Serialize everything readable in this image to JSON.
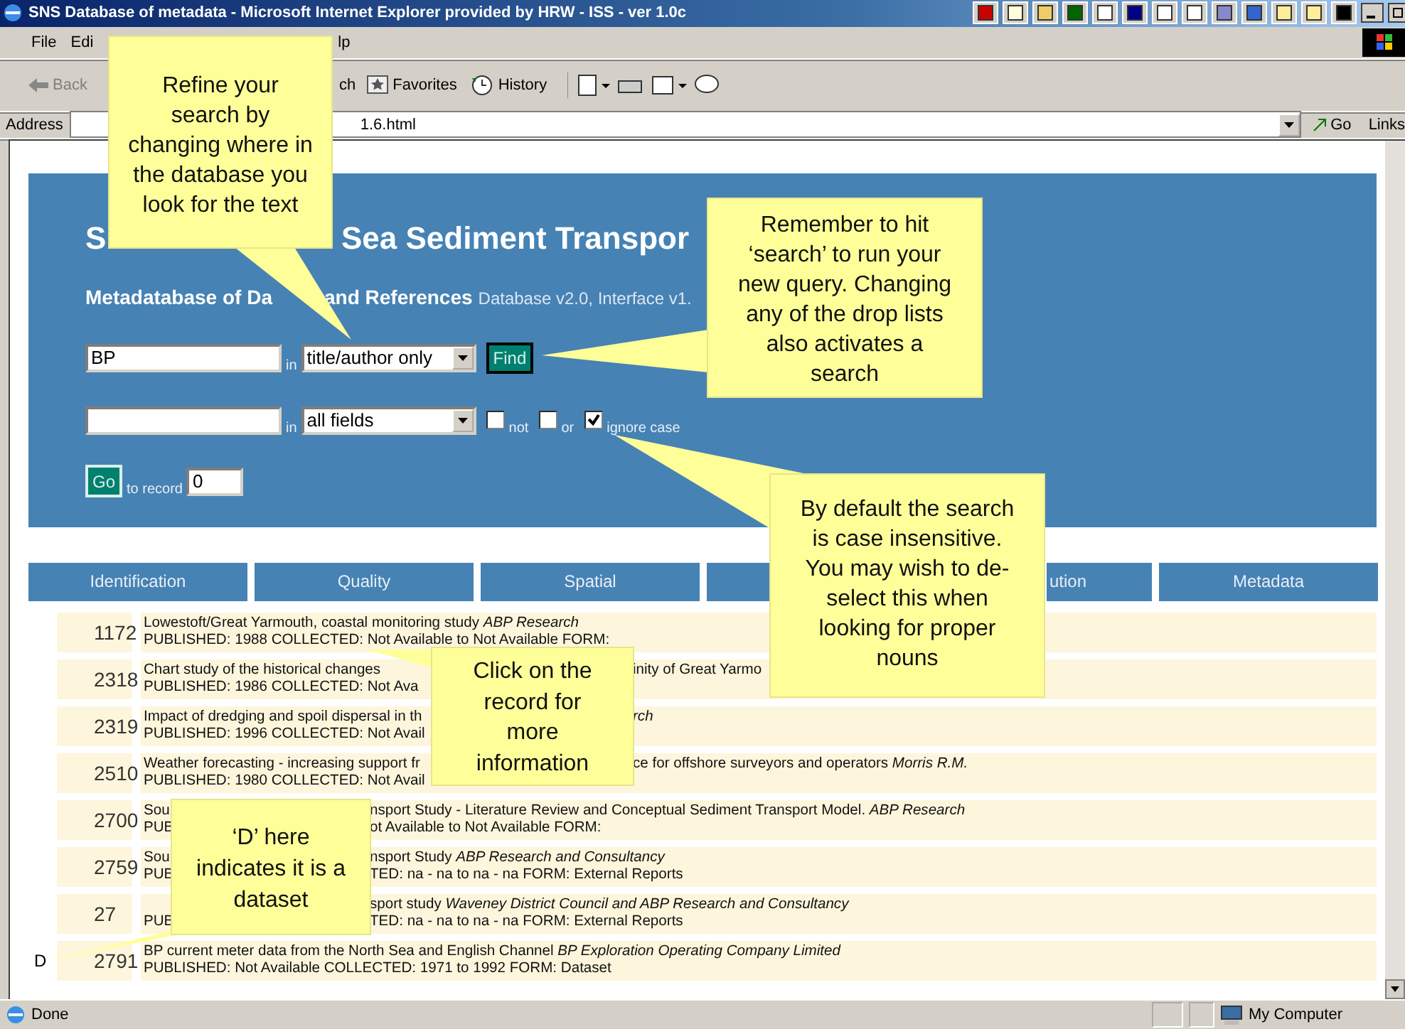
{
  "window": {
    "title": "SNS Database of metadata - Microsoft Internet Explorer provided by HRW - ISS - ver 1.0c"
  },
  "menu": [
    "File",
    "Edi",
    "lp"
  ],
  "toolbar": [
    {
      "label": "Back",
      "disabled": true
    },
    {
      "label": "ch",
      "disabled": false
    },
    {
      "label": "Favorites",
      "disabled": false
    },
    {
      "label": "History",
      "disabled": false
    }
  ],
  "address": {
    "label": "Address",
    "value": "1.6.html",
    "go": "Go",
    "links": "Links"
  },
  "page": {
    "title": {
      "left": "S",
      "right": "Sea Sediment Transpor"
    },
    "subtitle": {
      "left": "Metadatabase of Da",
      "right": "and References"
    },
    "version": "Database v2.0, Interface v1.",
    "query1": {
      "value": "BP",
      "in": "in",
      "field": "title/author only",
      "button": "Find"
    },
    "query2": {
      "in": "in",
      "field": "all fields",
      "checks": [
        {
          "label": "not",
          "checked": false
        },
        {
          "label": "or",
          "checked": false
        },
        {
          "label": "ignore case",
          "checked": true
        }
      ]
    },
    "goto": {
      "button": "Go",
      "label": "to record",
      "value": "0"
    }
  },
  "column_tabs": [
    {
      "kind": "labeled",
      "label": "Identification"
    },
    {
      "kind": "labeled",
      "label": "Quality"
    },
    {
      "kind": "labeled",
      "label": "Spatial"
    },
    {
      "kind": "covered"
    },
    {
      "kind": "cut",
      "label": "ution"
    },
    {
      "kind": "labeled",
      "label": "Metadata"
    }
  ],
  "records": [
    {
      "number": "1172",
      "line1": {
        "left": "Lowestoft/Great Yarmouth, coastal monitoring study *ABP Research*"
      },
      "line2": {
        "left": "PUBLISHED: 1988 COLLECTED: Not Available to Not Available FORM:"
      }
    },
    {
      "number": "2318",
      "line1": {
        "left": "Chart study of the historical changes",
        "right": "inity of Great Yarmo"
      },
      "line2": {
        "left": "PUBLISHED: 1986 COLLECTED: Not Ava"
      }
    },
    {
      "number": "2319",
      "line1": {
        "left": "Impact of dredging and spoil dispersal in th",
        "right": "*rch*"
      },
      "line2": {
        "left": "PUBLISHED: 1996 COLLECTED: Not Avail"
      }
    },
    {
      "number": "2510",
      "line1": {
        "left": "Weather forecasting - increasing support fr",
        "right": "ce for offshore surveyors and operators *Morris R.M.*"
      },
      "line2": {
        "left": "PUBLISHED: 1980 COLLECTED: Not Avail"
      }
    },
    {
      "number": "2700",
      "line1": {
        "left": "Sou",
        "right": "nsport Study - Literature Review and Conceptual Sediment Transport Model. *ABP Research*"
      },
      "line2": {
        "left": "PUB",
        "right": "ot Available to Not Available FORM:"
      }
    },
    {
      "number": "2759",
      "line1": {
        "left": "Sou",
        "right": "nsport Study *ABP Research and Consultancy*"
      },
      "line2": {
        "left": "PUB",
        "right": "TED: na - na to na - na FORM: External Reports"
      }
    },
    {
      "number": "27",
      "line1": {
        "right": "sport study *Waveney District Council and ABP Research and Consultancy*"
      },
      "line2": {
        "left": "PUB",
        "right": "TED: na - na to na - na FORM: External Reports"
      }
    },
    {
      "marker": "D",
      "number": "2791",
      "line1": {
        "left": "BP current meter data from the North Sea and English Channel *BP Exploration Operating Company Limited*"
      },
      "line2": {
        "left": "PUBLISHED: Not Available COLLECTED: 1971 to 1992 FORM: Dataset"
      }
    }
  ],
  "callouts": [
    {
      "lines": [
        "Refine your",
        "search by",
        "changing where in",
        "the database you",
        "look for the text"
      ]
    },
    {
      "lines": [
        "Remember to hit",
        "‘search’ to run your",
        "new query.  Changing",
        "any of the drop lists",
        "also activates a",
        "search"
      ]
    },
    {
      "lines": [
        "By default the search",
        "is case insensitive.",
        "You may wish to de-",
        "select this when",
        "looking for proper",
        "nouns"
      ]
    },
    {
      "lines": [
        "Click on the",
        "record for",
        "more",
        "information"
      ]
    },
    {
      "lines": [
        "‘D’ here",
        "indicates it is a",
        "dataset"
      ]
    }
  ],
  "status": {
    "text": "Done",
    "zone": "My Computer"
  }
}
